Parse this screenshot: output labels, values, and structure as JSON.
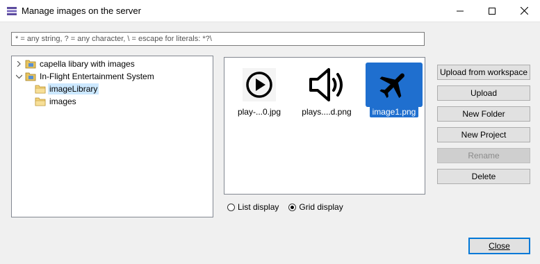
{
  "window": {
    "title": "Manage images on the server"
  },
  "filter": {
    "placeholder": "* = any string, ? = any character, \\ = escape for literals: *?\\"
  },
  "tree": {
    "items": [
      {
        "label": "capella libary with images",
        "expanded": false,
        "icon": "project-folder-icon"
      },
      {
        "label": "In-Flight Entertainment System",
        "expanded": true,
        "icon": "project-folder-icon"
      },
      {
        "label": "imageLibrary",
        "selected": true,
        "icon": "folder-icon"
      },
      {
        "label": "images",
        "icon": "folder-icon"
      }
    ]
  },
  "grid": {
    "items": [
      {
        "caption": "play-...0.jpg",
        "icon": "play-circle-icon"
      },
      {
        "caption": "plays....d.png",
        "icon": "speaker-icon"
      },
      {
        "caption": "image1.png",
        "icon": "airplane-icon",
        "selected": true
      }
    ]
  },
  "display": {
    "list_label": "List display",
    "grid_label": "Grid display",
    "selected": "grid"
  },
  "buttons": {
    "upload_workspace": "Upload from workspace",
    "upload": "Upload",
    "new_folder": "New Folder",
    "new_project": "New Project",
    "rename": "Rename",
    "delete": "Delete",
    "close": "Close"
  },
  "colors": {
    "selection_blue": "#1f6fcf",
    "tree_selection": "#cce8ff",
    "default_button_border": "#0078d7"
  }
}
